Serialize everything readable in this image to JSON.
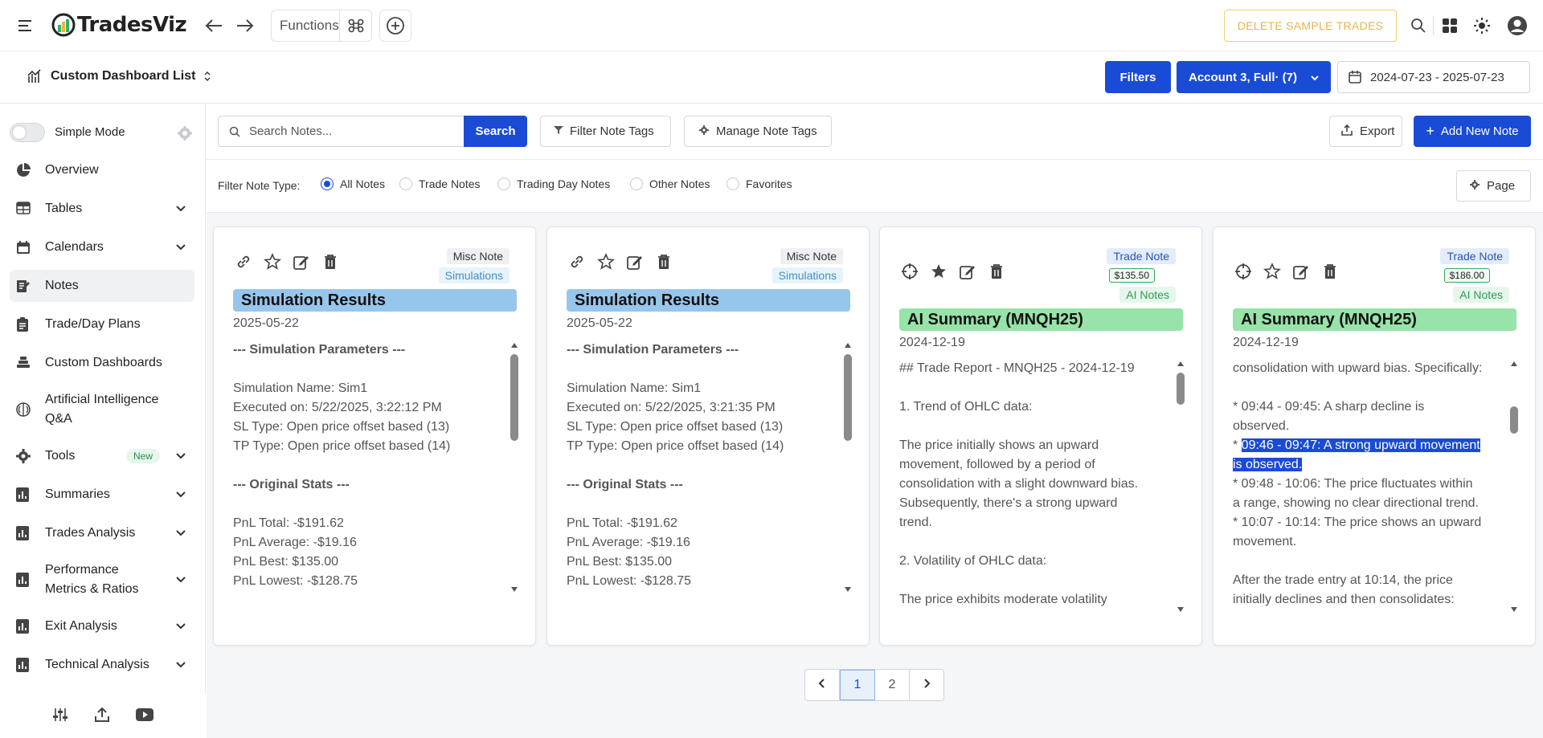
{
  "app": {
    "name": "TradesViz"
  },
  "topbar": {
    "functions_label": "Functions",
    "delete_sample_label": "DELETE SAMPLE TRADES"
  },
  "subbar": {
    "dashboard_title": "Custom Dashboard List",
    "filters_label": "Filters",
    "account_label": "Account 3, Full· (7)",
    "date_range": "2024-07-23 - 2025-07-23"
  },
  "sidebar": {
    "simple_mode_label": "Simple Mode",
    "items": [
      {
        "label": "Overview",
        "icon": "pie-chart-icon",
        "chevron": false
      },
      {
        "label": "Tables",
        "icon": "table-icon",
        "chevron": true
      },
      {
        "label": "Calendars",
        "icon": "calendar-icon",
        "chevron": true
      },
      {
        "label": "Notes",
        "icon": "notes-edit-icon",
        "chevron": false,
        "active": true
      },
      {
        "label": "Trade/Day Plans",
        "icon": "clipboard-icon",
        "chevron": false
      },
      {
        "label": "Custom Dashboards",
        "icon": "layers-icon",
        "chevron": false
      },
      {
        "label": "Artificial Intelligence Q&A",
        "icon": "brain-icon",
        "chevron": false
      },
      {
        "label": "Tools",
        "icon": "gear-icon",
        "chevron": true,
        "badge": "New"
      },
      {
        "label": "Summaries",
        "icon": "bar-chart-icon",
        "chevron": true
      },
      {
        "label": "Trades Analysis",
        "icon": "bar-chart-icon",
        "chevron": true
      },
      {
        "label": "Performance Metrics & Ratios",
        "icon": "metrics-icon",
        "chevron": true
      },
      {
        "label": "Exit Analysis",
        "icon": "bar-chart-icon",
        "chevron": true
      },
      {
        "label": "Technical Analysis",
        "icon": "bar-chart-icon",
        "chevron": true
      }
    ]
  },
  "toolbar": {
    "search_placeholder": "Search Notes...",
    "search_label": "Search",
    "filter_tags_label": "Filter Note Tags",
    "manage_tags_label": "Manage Note Tags",
    "export_label": "Export",
    "add_note_label": "Add New Note"
  },
  "filter_type": {
    "label": "Filter Note Type:",
    "options": [
      "All Notes",
      "Trade Notes",
      "Trading Day Notes",
      "Other Notes",
      "Favorites"
    ],
    "selected": "All Notes",
    "page_label": "Page"
  },
  "cards": [
    {
      "tags": [
        "Misc Note",
        "Simulations"
      ],
      "title": "Simulation Results",
      "date": "2025-05-22",
      "lines": [
        "--- Simulation Parameters ---",
        "",
        "Simulation Name: Sim1",
        "Executed on: 5/22/2025, 3:22:12 PM",
        "SL Type: Open price offset based (13)",
        "TP Type: Open price offset based (14)",
        "",
        "--- Original Stats ---",
        "",
        "PnL Total: -$191.62",
        "PnL Average: -$19.16",
        "PnL Best: $135.00",
        "PnL Lowest: -$128.75"
      ]
    },
    {
      "tags": [
        "Misc Note",
        "Simulations"
      ],
      "title": "Simulation Results",
      "date": "2025-05-22",
      "lines": [
        "--- Simulation Parameters ---",
        "",
        "Simulation Name: Sim1",
        "Executed on: 5/22/2025, 3:21:35 PM",
        "SL Type: Open price offset based (13)",
        "TP Type: Open price offset based (14)",
        "",
        "--- Original Stats ---",
        "",
        "PnL Total: -$191.62",
        "PnL Average: -$19.16",
        "PnL Best: $135.00",
        "PnL Lowest: -$128.75"
      ]
    },
    {
      "tags": [
        "Trade Note",
        "$135.50",
        "AI Notes"
      ],
      "title": "AI Summary (MNQH25)",
      "date": "2024-12-19",
      "lines": [
        "## Trade Report - MNQH25 - 2024-12-19",
        "",
        "1. Trend of OHLC data:",
        "",
        "The price initially shows an upward",
        "movement, followed by a period of",
        "consolidation with a slight downward bias.",
        "Subsequently, there's a strong upward",
        "trend.",
        "",
        "2. Volatility of OHLC data:",
        "",
        "The price exhibits moderate volatility"
      ]
    },
    {
      "tags": [
        "Trade Note",
        "$186.00",
        "AI Notes"
      ],
      "title": "AI Summary (MNQH25)",
      "date": "2024-12-19",
      "lines": [
        "consolidation with upward bias. Specifically:",
        "",
        "* 09:44 - 09:45: A sharp decline is",
        "observed.",
        "* 09:46 - 09:47: A strong upward movement",
        "is observed.",
        "* 09:48 - 10:06: The price fluctuates within",
        "a range, showing no clear directional trend.",
        "* 10:07 - 10:14: The price shows an upward",
        "movement.",
        "",
        "After the trade entry at 10:14, the price",
        "initially declines and then consolidates:"
      ]
    }
  ],
  "pagination": {
    "pages": [
      "1",
      "2"
    ],
    "current": "1"
  }
}
